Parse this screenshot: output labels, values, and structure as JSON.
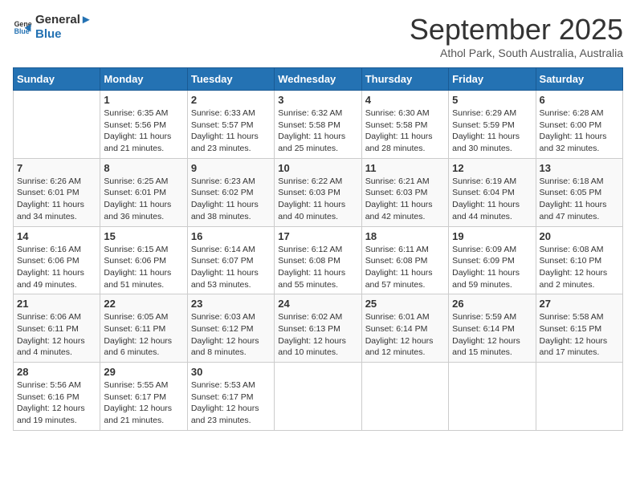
{
  "header": {
    "logo_line1": "General",
    "logo_line2": "Blue",
    "month": "September 2025",
    "location": "Athol Park, South Australia, Australia"
  },
  "days_of_week": [
    "Sunday",
    "Monday",
    "Tuesday",
    "Wednesday",
    "Thursday",
    "Friday",
    "Saturday"
  ],
  "weeks": [
    [
      {
        "day": "",
        "info": ""
      },
      {
        "day": "1",
        "info": "Sunrise: 6:35 AM\nSunset: 5:56 PM\nDaylight: 11 hours\nand 21 minutes."
      },
      {
        "day": "2",
        "info": "Sunrise: 6:33 AM\nSunset: 5:57 PM\nDaylight: 11 hours\nand 23 minutes."
      },
      {
        "day": "3",
        "info": "Sunrise: 6:32 AM\nSunset: 5:58 PM\nDaylight: 11 hours\nand 25 minutes."
      },
      {
        "day": "4",
        "info": "Sunrise: 6:30 AM\nSunset: 5:58 PM\nDaylight: 11 hours\nand 28 minutes."
      },
      {
        "day": "5",
        "info": "Sunrise: 6:29 AM\nSunset: 5:59 PM\nDaylight: 11 hours\nand 30 minutes."
      },
      {
        "day": "6",
        "info": "Sunrise: 6:28 AM\nSunset: 6:00 PM\nDaylight: 11 hours\nand 32 minutes."
      }
    ],
    [
      {
        "day": "7",
        "info": "Sunrise: 6:26 AM\nSunset: 6:01 PM\nDaylight: 11 hours\nand 34 minutes."
      },
      {
        "day": "8",
        "info": "Sunrise: 6:25 AM\nSunset: 6:01 PM\nDaylight: 11 hours\nand 36 minutes."
      },
      {
        "day": "9",
        "info": "Sunrise: 6:23 AM\nSunset: 6:02 PM\nDaylight: 11 hours\nand 38 minutes."
      },
      {
        "day": "10",
        "info": "Sunrise: 6:22 AM\nSunset: 6:03 PM\nDaylight: 11 hours\nand 40 minutes."
      },
      {
        "day": "11",
        "info": "Sunrise: 6:21 AM\nSunset: 6:03 PM\nDaylight: 11 hours\nand 42 minutes."
      },
      {
        "day": "12",
        "info": "Sunrise: 6:19 AM\nSunset: 6:04 PM\nDaylight: 11 hours\nand 44 minutes."
      },
      {
        "day": "13",
        "info": "Sunrise: 6:18 AM\nSunset: 6:05 PM\nDaylight: 11 hours\nand 47 minutes."
      }
    ],
    [
      {
        "day": "14",
        "info": "Sunrise: 6:16 AM\nSunset: 6:06 PM\nDaylight: 11 hours\nand 49 minutes."
      },
      {
        "day": "15",
        "info": "Sunrise: 6:15 AM\nSunset: 6:06 PM\nDaylight: 11 hours\nand 51 minutes."
      },
      {
        "day": "16",
        "info": "Sunrise: 6:14 AM\nSunset: 6:07 PM\nDaylight: 11 hours\nand 53 minutes."
      },
      {
        "day": "17",
        "info": "Sunrise: 6:12 AM\nSunset: 6:08 PM\nDaylight: 11 hours\nand 55 minutes."
      },
      {
        "day": "18",
        "info": "Sunrise: 6:11 AM\nSunset: 6:08 PM\nDaylight: 11 hours\nand 57 minutes."
      },
      {
        "day": "19",
        "info": "Sunrise: 6:09 AM\nSunset: 6:09 PM\nDaylight: 11 hours\nand 59 minutes."
      },
      {
        "day": "20",
        "info": "Sunrise: 6:08 AM\nSunset: 6:10 PM\nDaylight: 12 hours\nand 2 minutes."
      }
    ],
    [
      {
        "day": "21",
        "info": "Sunrise: 6:06 AM\nSunset: 6:11 PM\nDaylight: 12 hours\nand 4 minutes."
      },
      {
        "day": "22",
        "info": "Sunrise: 6:05 AM\nSunset: 6:11 PM\nDaylight: 12 hours\nand 6 minutes."
      },
      {
        "day": "23",
        "info": "Sunrise: 6:03 AM\nSunset: 6:12 PM\nDaylight: 12 hours\nand 8 minutes."
      },
      {
        "day": "24",
        "info": "Sunrise: 6:02 AM\nSunset: 6:13 PM\nDaylight: 12 hours\nand 10 minutes."
      },
      {
        "day": "25",
        "info": "Sunrise: 6:01 AM\nSunset: 6:14 PM\nDaylight: 12 hours\nand 12 minutes."
      },
      {
        "day": "26",
        "info": "Sunrise: 5:59 AM\nSunset: 6:14 PM\nDaylight: 12 hours\nand 15 minutes."
      },
      {
        "day": "27",
        "info": "Sunrise: 5:58 AM\nSunset: 6:15 PM\nDaylight: 12 hours\nand 17 minutes."
      }
    ],
    [
      {
        "day": "28",
        "info": "Sunrise: 5:56 AM\nSunset: 6:16 PM\nDaylight: 12 hours\nand 19 minutes."
      },
      {
        "day": "29",
        "info": "Sunrise: 5:55 AM\nSunset: 6:17 PM\nDaylight: 12 hours\nand 21 minutes."
      },
      {
        "day": "30",
        "info": "Sunrise: 5:53 AM\nSunset: 6:17 PM\nDaylight: 12 hours\nand 23 minutes."
      },
      {
        "day": "",
        "info": ""
      },
      {
        "day": "",
        "info": ""
      },
      {
        "day": "",
        "info": ""
      },
      {
        "day": "",
        "info": ""
      }
    ]
  ]
}
